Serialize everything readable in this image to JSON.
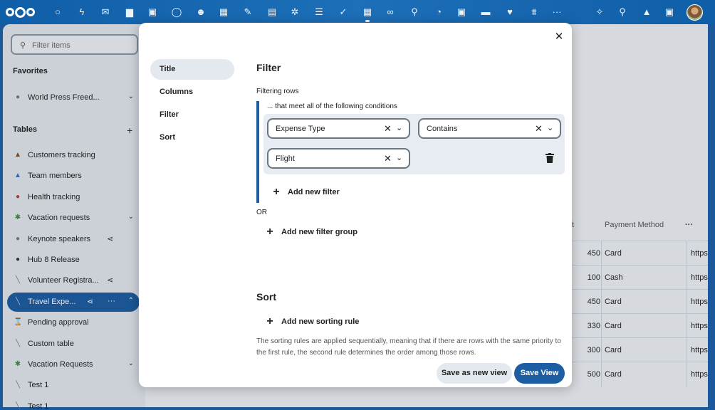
{
  "topbar": {
    "apps": [
      {
        "name": "dashboard-icon",
        "glyph": "○"
      },
      {
        "name": "activity-icon",
        "glyph": "ϟ"
      },
      {
        "name": "mail-icon",
        "glyph": "✉"
      },
      {
        "name": "files-icon",
        "glyph": "▆"
      },
      {
        "name": "photos-icon",
        "glyph": "▣"
      },
      {
        "name": "talk-icon",
        "glyph": "◯"
      },
      {
        "name": "contacts-icon",
        "glyph": "☻"
      },
      {
        "name": "calendar-icon",
        "glyph": "▦"
      },
      {
        "name": "notes-icon",
        "glyph": "✎"
      },
      {
        "name": "deck-icon",
        "glyph": "▤"
      },
      {
        "name": "tasks-icon",
        "glyph": "✲"
      },
      {
        "name": "list-icon",
        "glyph": "☰"
      },
      {
        "name": "check-icon",
        "glyph": "✓"
      },
      {
        "name": "tables-icon",
        "glyph": "▦",
        "active": true
      },
      {
        "name": "link-icon",
        "glyph": "∞"
      },
      {
        "name": "maps-icon",
        "glyph": "⚲"
      },
      {
        "name": "dashboard-gauge-icon",
        "glyph": "◔"
      },
      {
        "name": "transport-icon",
        "glyph": "▣"
      },
      {
        "name": "briefcase-icon",
        "glyph": "▬"
      },
      {
        "name": "health-icon",
        "glyph": "♥"
      },
      {
        "name": "analytics-icon",
        "glyph": "⩩"
      },
      {
        "name": "more-apps-icon",
        "glyph": "···"
      }
    ],
    "right": [
      {
        "name": "assistant-icon",
        "glyph": "✧"
      },
      {
        "name": "search-icon",
        "glyph": "⚲"
      },
      {
        "name": "notifications-icon",
        "glyph": "▲"
      },
      {
        "name": "contacts-menu-icon",
        "glyph": "▣"
      }
    ]
  },
  "sidebar": {
    "filter_placeholder": "Filter items",
    "favorites_title": "Favorites",
    "favorites": [
      {
        "label": "World Press Freed...",
        "emoji": "●",
        "chevron": true
      }
    ],
    "tables_title": "Tables",
    "tables": [
      {
        "label": "Customers tracking",
        "emoji": "▲",
        "color": "#8b4513"
      },
      {
        "label": "Team members",
        "emoji": "▲",
        "color": "#3b6fb5"
      },
      {
        "label": "Health tracking",
        "emoji": "●",
        "color": "#c0392b"
      },
      {
        "label": "Vacation requests",
        "emoji": "✱",
        "color": "#3a8a3a",
        "chevron": true
      },
      {
        "label": "Keynote speakers",
        "emoji": "●",
        "color": "#777",
        "share": true
      },
      {
        "label": "Hub 8 Release",
        "emoji": "●",
        "color": "#333"
      },
      {
        "label": "Volunteer Registra...",
        "emoji": "╲",
        "color": "#777",
        "share": true
      },
      {
        "label": "Travel Expe...",
        "emoji": "╲",
        "color": "#ccc",
        "share": true,
        "more": true,
        "chevron_up": true,
        "active": true
      },
      {
        "label": "Pending approval",
        "emoji": "⌛",
        "color": "#777"
      },
      {
        "label": "Custom table",
        "emoji": "╲",
        "color": "#777"
      },
      {
        "label": "Vacation Requests",
        "emoji": "✱",
        "color": "#3a8a3a",
        "chevron": true
      },
      {
        "label": "Test 1",
        "emoji": "╲",
        "color": "#777"
      },
      {
        "label": "Test 1",
        "emoji": "╲",
        "color": "#777"
      }
    ]
  },
  "table": {
    "col_partial": "t",
    "col_payment": "Payment Method",
    "more": "···",
    "rows": [
      {
        "amount": "450",
        "method": "Card",
        "link": "https"
      },
      {
        "amount": "100",
        "method": "Cash",
        "link": "https"
      },
      {
        "amount": "450",
        "method": "Card",
        "link": "https"
      },
      {
        "amount": "330",
        "method": "Card",
        "link": "https"
      },
      {
        "amount": "300",
        "method": "Card",
        "link": "https"
      },
      {
        "amount": "500",
        "method": "Card",
        "link": "https"
      }
    ]
  },
  "modal": {
    "close": "✕",
    "nav": [
      "Title",
      "Columns",
      "Filter",
      "Sort"
    ],
    "filter": {
      "heading": "Filter",
      "filtering_rows": "Filtering rows",
      "meet": "... that meet all of the following conditions",
      "column_value": "Expense Type",
      "operator_value": "Contains",
      "search_value": "Flight",
      "add_filter": "Add new filter",
      "or": "OR",
      "add_group": "Add new filter group"
    },
    "sort": {
      "heading": "Sort",
      "add_rule": "Add new sorting rule",
      "description": "The sorting rules are applied sequentially, meaning that if there are rows with the same priority to the first rule, the second rule determines the order among those rows."
    },
    "buttons": {
      "save_new": "Save as new view",
      "save": "Save View"
    }
  }
}
